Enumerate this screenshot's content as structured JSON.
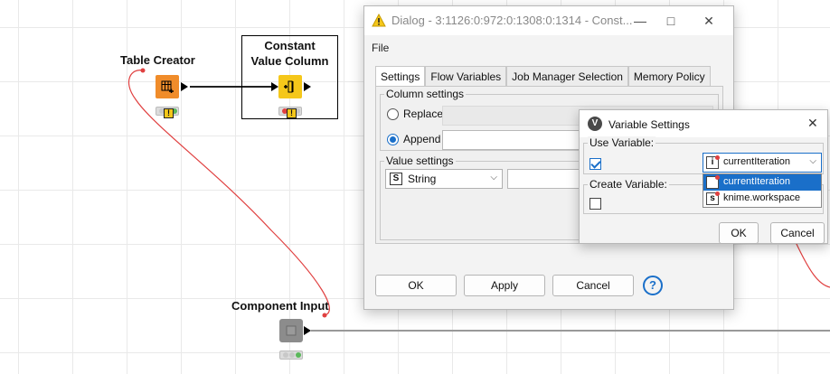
{
  "canvas": {
    "nodes": {
      "table_creator": {
        "label": "Table Creator"
      },
      "constant_value_column": {
        "label_line1": "Constant",
        "label_line2": "Value Column"
      },
      "component_input": {
        "label": "Component Input"
      }
    }
  },
  "dialog": {
    "title": "Dialog - 3:1126:0:972:0:1308:0:1314 - Const...",
    "menu": [
      "File"
    ],
    "tabs": [
      "Settings",
      "Flow Variables",
      "Job Manager Selection",
      "Memory Policy"
    ],
    "active_tab": "Settings",
    "column_settings": {
      "label": "Column settings",
      "replace_label": "Replace",
      "append_label": "Append",
      "selected": "Append"
    },
    "value_settings": {
      "label": "Value settings",
      "type_badge": "S",
      "type_value": "String"
    },
    "buttons": {
      "ok": "OK",
      "apply": "Apply",
      "cancel": "Cancel",
      "help": "?"
    }
  },
  "variable_settings": {
    "title": "Variable Settings",
    "logo": "V",
    "use_variable_label": "Use Variable:",
    "use_variable_checked": true,
    "selected_variable": "currentIteration",
    "selected_variable_badge": "i",
    "create_variable_label": "Create Variable:",
    "create_variable_checked": false,
    "options": [
      {
        "badge": "i",
        "label": "currentIteration"
      },
      {
        "badge": "s",
        "label": "knime.workspace"
      }
    ],
    "buttons": {
      "ok": "OK",
      "cancel": "Cancel"
    }
  },
  "colors": {
    "accent": "#1a6fc9",
    "node_orange": "#f08c2a",
    "node_yellow": "#f5c71a",
    "wire_red": "#e04040"
  }
}
